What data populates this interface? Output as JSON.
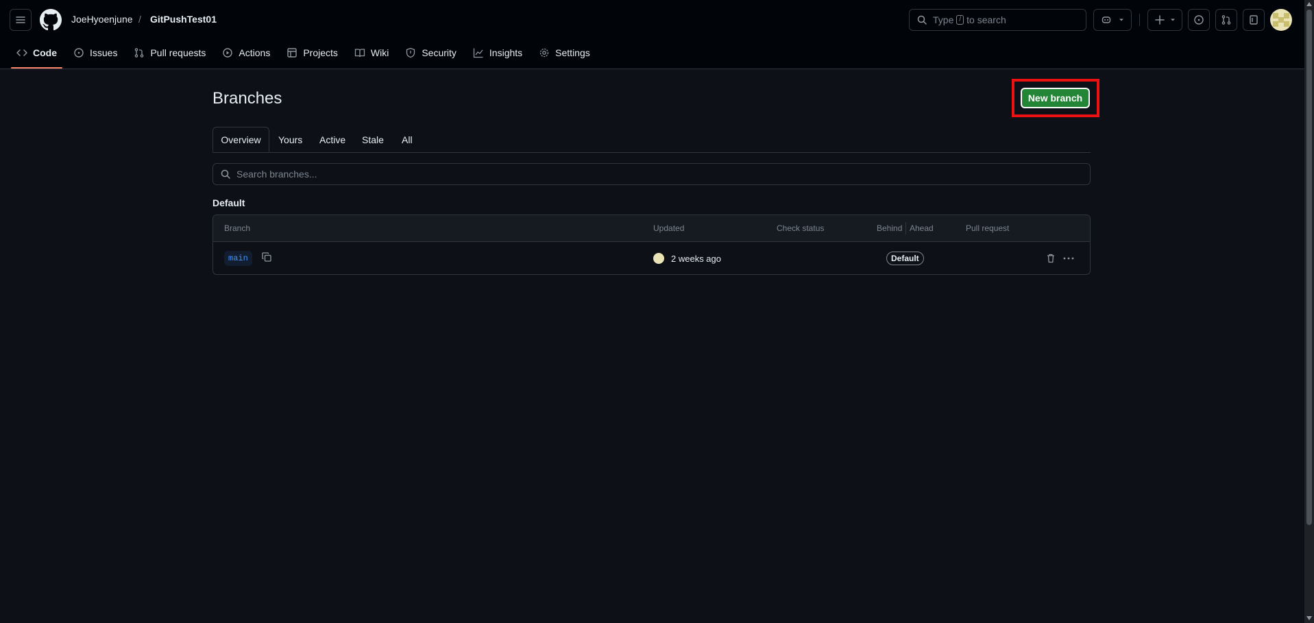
{
  "header": {
    "owner": "JoeHyoenjune",
    "separator": "/",
    "repo": "GitPushTest01",
    "search_prefix": "Type",
    "search_key": "/",
    "search_suffix": "to search"
  },
  "nav": {
    "code": "Code",
    "issues": "Issues",
    "pulls": "Pull requests",
    "actions": "Actions",
    "projects": "Projects",
    "wiki": "Wiki",
    "security": "Security",
    "insights": "Insights",
    "settings": "Settings"
  },
  "page": {
    "title": "Branches",
    "new_branch": "New branch",
    "tabs": [
      "Overview",
      "Yours",
      "Active",
      "Stale",
      "All"
    ],
    "search_placeholder": "Search branches...",
    "section": "Default"
  },
  "table": {
    "headers": [
      "Branch",
      "Updated",
      "Check status",
      "Behind",
      "Ahead",
      "Pull request"
    ],
    "rows": [
      {
        "branch": "main",
        "updated": "2 weeks ago",
        "badge": "Default"
      }
    ]
  },
  "colors": {
    "accent": "#f78166",
    "primary": "#238636",
    "highlight": "#e11111",
    "link": "#4493f8"
  }
}
